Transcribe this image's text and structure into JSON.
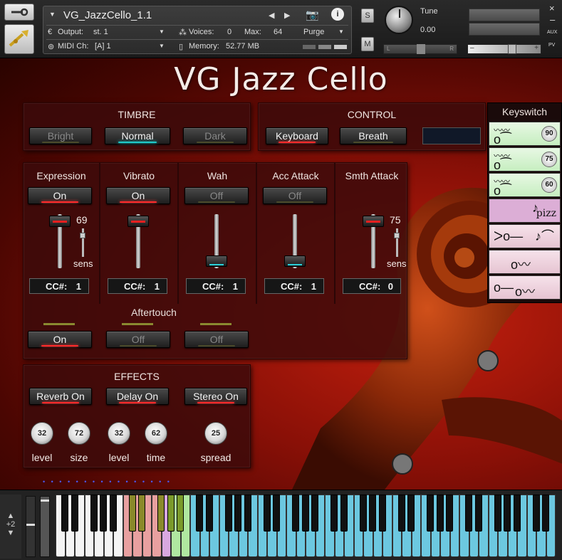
{
  "header": {
    "instrument_name": "VG_JazzCello_1.1",
    "output_label": "Output:",
    "output_value": "st. 1",
    "voices_label": "Voices:",
    "voices_value": "0",
    "max_label": "Max:",
    "max_value": "64",
    "purge_label": "Purge",
    "midi_label": "MIDI Ch:",
    "midi_value": "[A]  1",
    "memory_label": "Memory:",
    "memory_value": "52.77 MB",
    "solo_label": "S",
    "mute_label": "M",
    "tune_label": "Tune",
    "tune_value": "0.00",
    "pan_left": "L",
    "pan_right": "R",
    "aux_label": "AUX",
    "pv_label": "PV",
    "close_glyph": "×",
    "minus_glyph": "–",
    "plus_glyph": "+"
  },
  "title": "VG Jazz Cello",
  "timbre": {
    "heading": "TIMBRE",
    "buttons": [
      "Bright",
      "Normal",
      "Dark"
    ]
  },
  "control": {
    "heading": "CONTROL",
    "buttons": [
      "Keyboard",
      "Breath"
    ]
  },
  "columns": [
    {
      "title": "Expression",
      "state": "On",
      "value": "69",
      "sens": "sens",
      "cc_label": "CC#:",
      "cc": "1"
    },
    {
      "title": "Vibrato",
      "state": "On",
      "cc_label": "CC#:",
      "cc": "1"
    },
    {
      "title": "Wah",
      "state": "Off",
      "cc_label": "CC#:",
      "cc": "1"
    },
    {
      "title": "Acc Attack",
      "state": "Off",
      "cc_label": "CC#:",
      "cc": "1"
    },
    {
      "title": "Smth Attack",
      "value": "75",
      "sens": "sens",
      "cc_label": "CC#:",
      "cc": "0"
    }
  ],
  "aftertouch": {
    "label": "Aftertouch",
    "buttons": [
      "On",
      "Off",
      "Off"
    ]
  },
  "effects": {
    "heading": "EFFECTS",
    "buttons": [
      "Reverb On",
      "Delay On",
      "Stereo On"
    ],
    "knobs": [
      {
        "value": "32",
        "label": "level"
      },
      {
        "value": "72",
        "label": "size"
      },
      {
        "value": "32",
        "label": "level"
      },
      {
        "value": "62",
        "label": "time"
      },
      {
        "value": "25",
        "label": "spread"
      }
    ]
  },
  "keyswitch": {
    "heading": "Keyswitch",
    "items": [
      {
        "badge": "90"
      },
      {
        "badge": "75"
      },
      {
        "badge": "60"
      },
      {
        "label": "pizz"
      },
      {},
      {},
      {}
    ]
  },
  "keyboard": {
    "octave_value": "+2"
  },
  "colors": {
    "accent_red": "#ff2a2a",
    "accent_teal": "#1ec8c8",
    "keyswitch_green": "#c6eec0",
    "keyswitch_pink": "#e6c4d2",
    "keyswitch_purple": "#dcaed6",
    "key_pink": "#e8a0a0",
    "key_green": "#b0e8a0",
    "key_blue": "#6cc8e0"
  }
}
